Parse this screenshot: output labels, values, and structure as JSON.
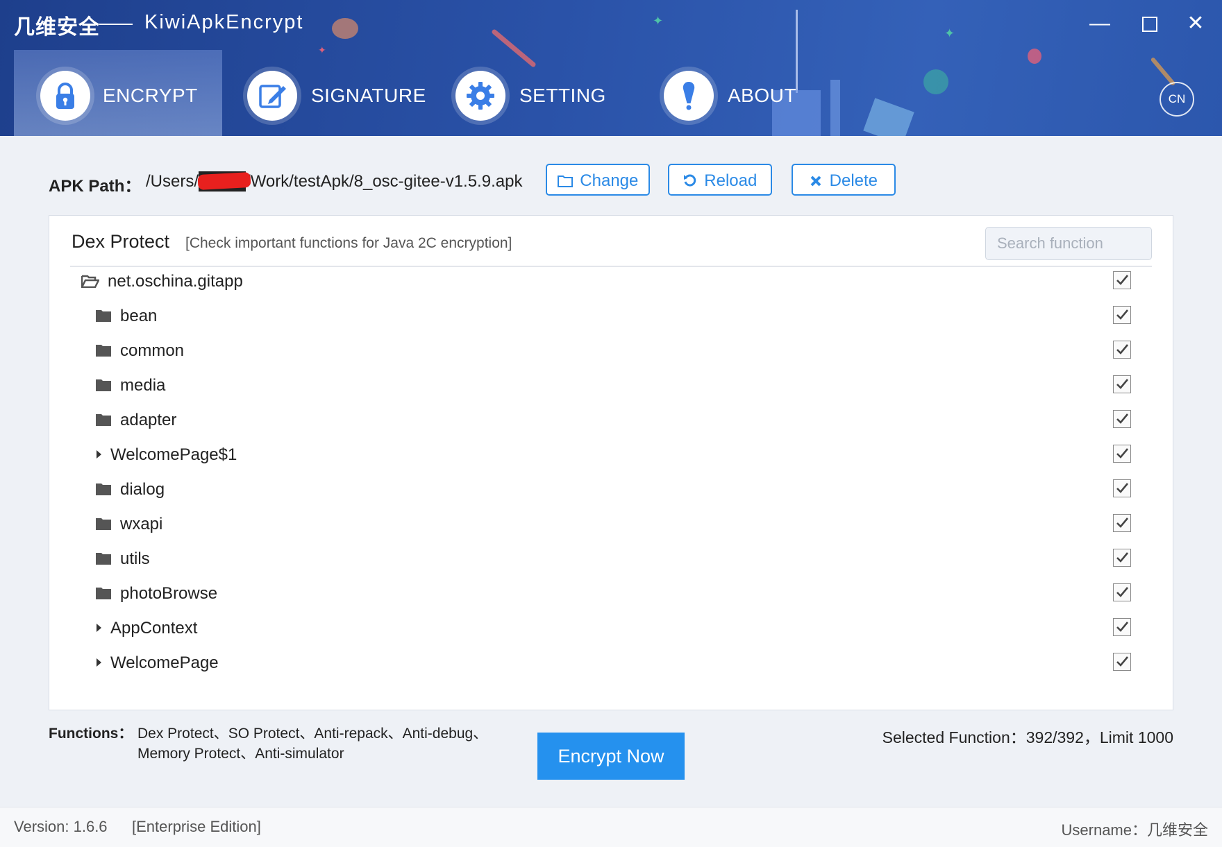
{
  "window": {
    "brand": "几维安全",
    "title": "KiwiApkEncrypt",
    "minimize_glyph": "—",
    "maximize_glyph": "☐",
    "close_glyph": "✕"
  },
  "tabs": [
    {
      "label": "ENCRYPT",
      "icon": "lock-icon",
      "active": true
    },
    {
      "label": "SIGNATURE",
      "icon": "edit-icon",
      "active": false
    },
    {
      "label": "SETTING",
      "icon": "gear-icon",
      "active": false
    },
    {
      "label": "ABOUT",
      "icon": "exclamation-icon",
      "active": false
    }
  ],
  "language_toggle": "CN",
  "apk": {
    "label": "APK Path：",
    "path": "/Users/████/Work/testApk/8_osc-gitee-v1.5.9.apk",
    "change_label": "Change",
    "reload_label": "Reload",
    "delete_label": "Delete"
  },
  "dex_protect": {
    "title": "Dex Protect",
    "hint": "[Check important functions for Java 2C encryption]",
    "search_placeholder": "Search function",
    "tree": [
      {
        "name": "net.oschina.gitapp",
        "type": "folder-open",
        "checked": true
      },
      {
        "name": "bean",
        "type": "folder",
        "checked": true
      },
      {
        "name": "common",
        "type": "folder",
        "checked": true
      },
      {
        "name": "media",
        "type": "folder",
        "checked": true
      },
      {
        "name": "adapter",
        "type": "folder",
        "checked": true
      },
      {
        "name": "WelcomePage$1",
        "type": "class",
        "checked": true
      },
      {
        "name": "dialog",
        "type": "folder",
        "checked": true
      },
      {
        "name": "wxapi",
        "type": "folder",
        "checked": true
      },
      {
        "name": "utils",
        "type": "folder",
        "checked": true
      },
      {
        "name": "photoBrowse",
        "type": "folder",
        "checked": true
      },
      {
        "name": "AppContext",
        "type": "class",
        "checked": true
      },
      {
        "name": "WelcomePage",
        "type": "class",
        "checked": true
      }
    ]
  },
  "functions": {
    "label": "Functions：",
    "text": "Dex Protect、SO Protect、Anti-repack、Anti-debug、Memory Protect、Anti-simulator"
  },
  "encrypt_button": "Encrypt Now",
  "selected_function": "Selected Function：392/392，Limit 1000",
  "footer": {
    "version": "Version: 1.6.6",
    "edition": "[Enterprise Edition]",
    "username": "Username：几维安全"
  },
  "colors": {
    "header": "#2a52a8",
    "accent": "#2b8ae6",
    "primary_button": "#2591ee"
  }
}
